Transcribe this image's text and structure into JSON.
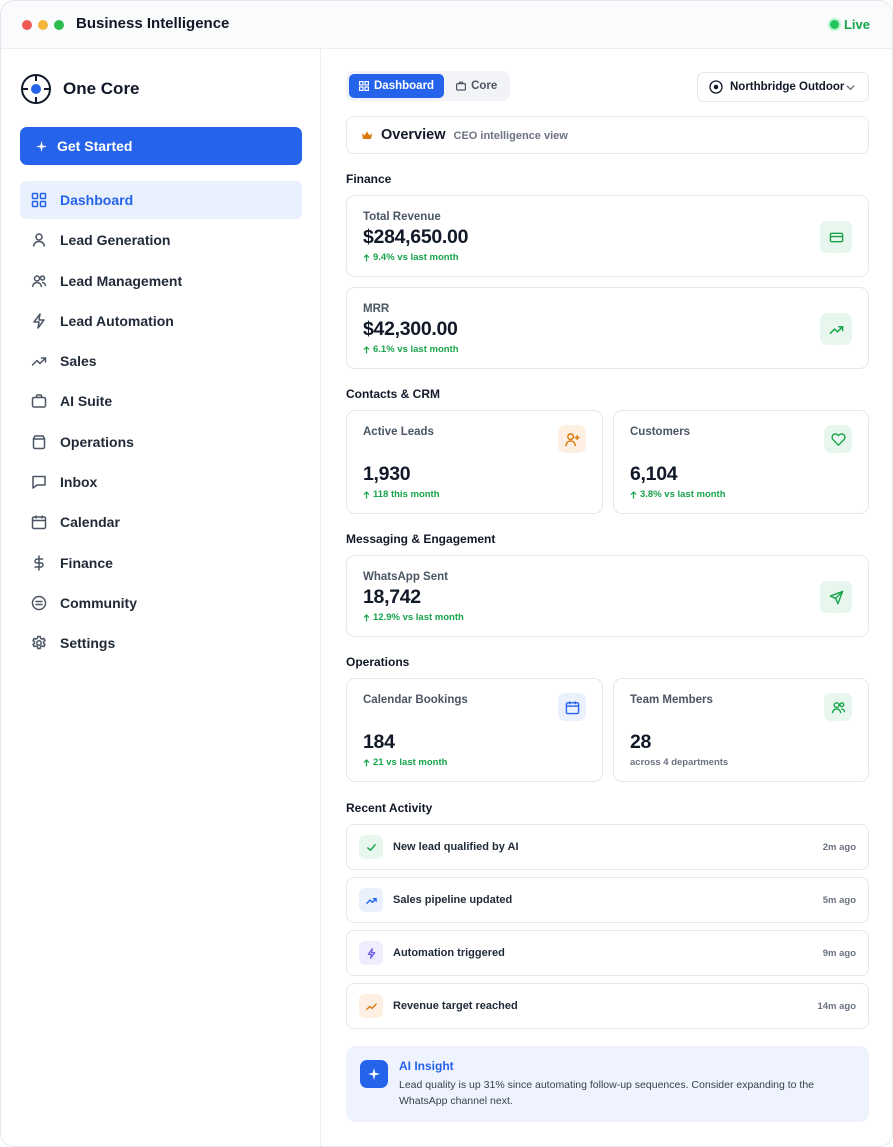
{
  "window": {
    "title": "Business Intelligence",
    "status": "Live"
  },
  "colors": {
    "accent": "#2563eb",
    "success": "#16a34a",
    "warning": "#d97706",
    "accent_bg": "#e8effd"
  },
  "sidebar": {
    "brand": "One Core",
    "cta": "Get Started",
    "items": [
      {
        "label": "Dashboard",
        "icon": "grid-icon",
        "active": true
      },
      {
        "label": "Lead Generation",
        "icon": "user-icon"
      },
      {
        "label": "Lead Management",
        "icon": "users-icon"
      },
      {
        "label": "Lead Automation",
        "icon": "bolt-icon"
      },
      {
        "label": "Sales",
        "icon": "trending-up-icon"
      },
      {
        "label": "AI Suite",
        "icon": "briefcase-icon"
      },
      {
        "label": "Operations",
        "icon": "bag-icon"
      },
      {
        "label": "Inbox",
        "icon": "message-icon"
      },
      {
        "label": "Calendar",
        "icon": "calendar-icon"
      },
      {
        "label": "Finance",
        "icon": "dollar-icon"
      },
      {
        "label": "Community",
        "icon": "smile-icon"
      },
      {
        "label": "Settings",
        "icon": "gear-icon"
      }
    ]
  },
  "header": {
    "tabs": [
      {
        "label": "Dashboard",
        "active": true
      },
      {
        "label": "Core"
      }
    ],
    "org": "Northbridge Outdoor"
  },
  "overview": {
    "title": "Overview",
    "subtitle": "CEO intelligence view"
  },
  "sections": {
    "finance": "Finance",
    "crm": "Contacts & CRM",
    "messaging": "Messaging & Engagement",
    "operations": "Operations",
    "activity": "Recent Activity"
  },
  "metrics": {
    "total_revenue": {
      "label": "Total Revenue",
      "value": "$284,650.00",
      "delta": "9.4% vs last month"
    },
    "mrr": {
      "label": "MRR",
      "value": "$42,300.00",
      "delta": "6.1% vs last month"
    },
    "active_leads": {
      "label": "Active Leads",
      "value": "1,930",
      "delta": "118 this month"
    },
    "customers": {
      "label": "Customers",
      "value": "6,104",
      "delta": "3.8% vs last month"
    },
    "whatsapp": {
      "label": "WhatsApp Sent",
      "value": "18,742",
      "delta": "12.9% vs last month"
    },
    "bookings": {
      "label": "Calendar Bookings",
      "value": "184",
      "delta": "21 vs last month"
    },
    "team": {
      "label": "Team Members",
      "value": "28",
      "note": "across 4 departments"
    }
  },
  "activity": [
    {
      "text": "New lead qualified by AI",
      "time": "2m ago",
      "icon": "check-icon"
    },
    {
      "text": "Sales pipeline updated",
      "time": "5m ago",
      "icon": "trending-up-icon"
    },
    {
      "text": "Automation triggered",
      "time": "9m ago",
      "icon": "bolt-icon"
    },
    {
      "text": "Revenue target reached",
      "time": "14m ago",
      "icon": "chart-icon"
    }
  ],
  "insight": {
    "title": "AI Insight",
    "text": "Lead quality is up 31% since automating follow-up sequences. Consider expanding to the WhatsApp channel next."
  }
}
